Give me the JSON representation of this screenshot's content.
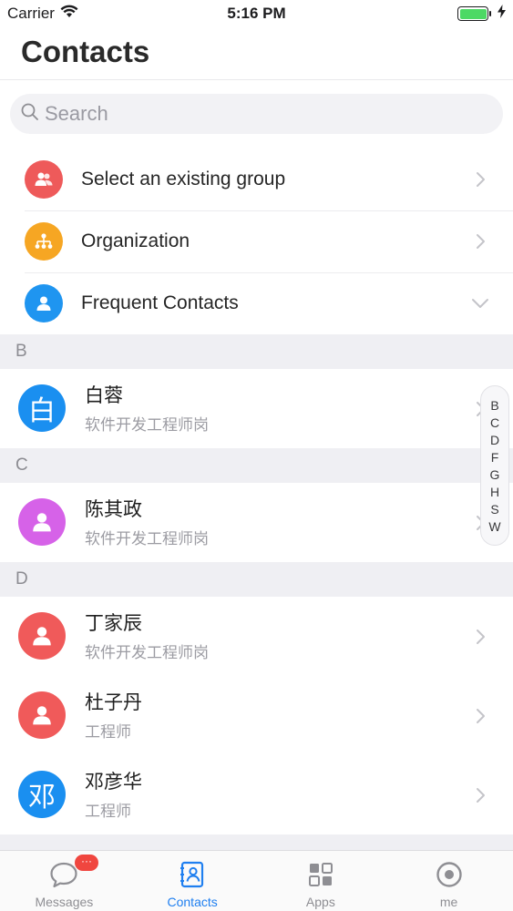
{
  "status_bar": {
    "carrier": "Carrier",
    "time": "5:16 PM",
    "battery_level": 1.0
  },
  "header": {
    "title": "Contacts"
  },
  "search": {
    "placeholder": "Search"
  },
  "menu": [
    {
      "label": "Select an existing group",
      "icon": "group-icon",
      "color": "#ee5a5a",
      "chevron": "right"
    },
    {
      "label": "Organization",
      "icon": "org-chart-icon",
      "color": "#f6a623",
      "chevron": "right"
    },
    {
      "label": "Frequent Contacts",
      "icon": "person-icon",
      "color": "#1f95f0",
      "chevron": "down"
    }
  ],
  "sections": [
    {
      "letter": "B",
      "contacts": [
        {
          "name": "白蓉",
          "title": "软件开发工程师岗",
          "avatar_text": "白",
          "avatar_color": "#1a8ff0"
        }
      ]
    },
    {
      "letter": "C",
      "contacts": [
        {
          "name": "陈其政",
          "title": "软件开发工程师岗",
          "avatar_text": "",
          "avatar_color": "#d662e8"
        }
      ]
    },
    {
      "letter": "D",
      "contacts": [
        {
          "name": "丁家辰",
          "title": "软件开发工程师岗",
          "avatar_text": "",
          "avatar_color": "#f05a5a"
        },
        {
          "name": "杜子丹",
          "title": "工程师",
          "avatar_text": "",
          "avatar_color": "#f05a5a"
        },
        {
          "name": "邓彦华",
          "title": "工程师",
          "avatar_text": "邓",
          "avatar_color": "#1a8ff0"
        }
      ]
    }
  ],
  "alpha_index": [
    "B",
    "C",
    "D",
    "F",
    "G",
    "H",
    "S",
    "W"
  ],
  "tabs": [
    {
      "label": "Messages",
      "icon": "chat-bubble-icon",
      "badge": "···",
      "active": false
    },
    {
      "label": "Contacts",
      "icon": "contacts-book-icon",
      "active": true
    },
    {
      "label": "Apps",
      "icon": "apps-grid-icon",
      "active": false
    },
    {
      "label": "me",
      "icon": "profile-circle-icon",
      "active": false
    }
  ],
  "colors": {
    "accent": "#1f7ff0",
    "badge": "#f0463f",
    "section_bg": "#efeff3"
  }
}
